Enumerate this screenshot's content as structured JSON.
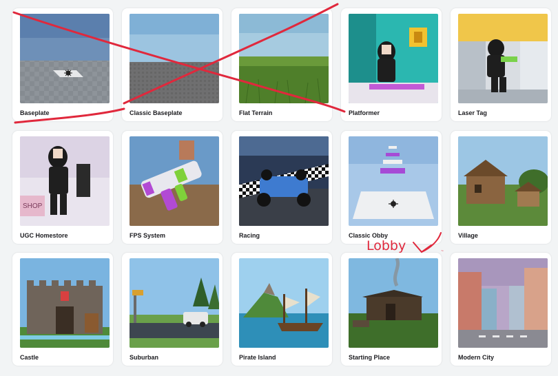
{
  "templates": [
    {
      "name": "Baseplate"
    },
    {
      "name": "Classic Baseplate"
    },
    {
      "name": "Flat Terrain"
    },
    {
      "name": "Platformer"
    },
    {
      "name": "Laser Tag"
    },
    {
      "name": "UGC Homestore"
    },
    {
      "name": "FPS System"
    },
    {
      "name": "Racing"
    },
    {
      "name": "Classic Obby"
    },
    {
      "name": "Village"
    },
    {
      "name": "Castle"
    },
    {
      "name": "Suburban"
    },
    {
      "name": "Pirate Island"
    },
    {
      "name": "Starting Place"
    },
    {
      "name": "Modern City"
    }
  ],
  "thumbnail_text": {
    "shop_sign": "SHOP"
  },
  "annotations": {
    "handwritten_label": "Lobby",
    "ink_color": "#e0283c",
    "crossed_out": [
      "Baseplate",
      "Classic Baseplate",
      "Flat Terrain",
      "Platformer"
    ],
    "underlined": "Baseplate",
    "arrow_points_to": "Classic Obby"
  },
  "colors": {
    "page_background": "#f2f4f5",
    "card_background": "#ffffff",
    "label_text": "#1b1b1f"
  }
}
